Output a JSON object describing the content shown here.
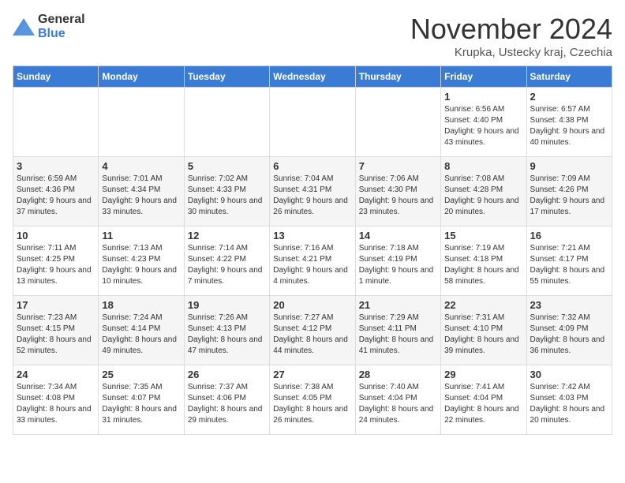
{
  "logo": {
    "general": "General",
    "blue": "Blue"
  },
  "title": "November 2024",
  "location": "Krupka, Ustecky kraj, Czechia",
  "days_of_week": [
    "Sunday",
    "Monday",
    "Tuesday",
    "Wednesday",
    "Thursday",
    "Friday",
    "Saturday"
  ],
  "weeks": [
    [
      {
        "day": "",
        "info": ""
      },
      {
        "day": "",
        "info": ""
      },
      {
        "day": "",
        "info": ""
      },
      {
        "day": "",
        "info": ""
      },
      {
        "day": "",
        "info": ""
      },
      {
        "day": "1",
        "info": "Sunrise: 6:56 AM\nSunset: 4:40 PM\nDaylight: 9 hours and 43 minutes."
      },
      {
        "day": "2",
        "info": "Sunrise: 6:57 AM\nSunset: 4:38 PM\nDaylight: 9 hours and 40 minutes."
      }
    ],
    [
      {
        "day": "3",
        "info": "Sunrise: 6:59 AM\nSunset: 4:36 PM\nDaylight: 9 hours and 37 minutes."
      },
      {
        "day": "4",
        "info": "Sunrise: 7:01 AM\nSunset: 4:34 PM\nDaylight: 9 hours and 33 minutes."
      },
      {
        "day": "5",
        "info": "Sunrise: 7:02 AM\nSunset: 4:33 PM\nDaylight: 9 hours and 30 minutes."
      },
      {
        "day": "6",
        "info": "Sunrise: 7:04 AM\nSunset: 4:31 PM\nDaylight: 9 hours and 26 minutes."
      },
      {
        "day": "7",
        "info": "Sunrise: 7:06 AM\nSunset: 4:30 PM\nDaylight: 9 hours and 23 minutes."
      },
      {
        "day": "8",
        "info": "Sunrise: 7:08 AM\nSunset: 4:28 PM\nDaylight: 9 hours and 20 minutes."
      },
      {
        "day": "9",
        "info": "Sunrise: 7:09 AM\nSunset: 4:26 PM\nDaylight: 9 hours and 17 minutes."
      }
    ],
    [
      {
        "day": "10",
        "info": "Sunrise: 7:11 AM\nSunset: 4:25 PM\nDaylight: 9 hours and 13 minutes."
      },
      {
        "day": "11",
        "info": "Sunrise: 7:13 AM\nSunset: 4:23 PM\nDaylight: 9 hours and 10 minutes."
      },
      {
        "day": "12",
        "info": "Sunrise: 7:14 AM\nSunset: 4:22 PM\nDaylight: 9 hours and 7 minutes."
      },
      {
        "day": "13",
        "info": "Sunrise: 7:16 AM\nSunset: 4:21 PM\nDaylight: 9 hours and 4 minutes."
      },
      {
        "day": "14",
        "info": "Sunrise: 7:18 AM\nSunset: 4:19 PM\nDaylight: 9 hours and 1 minute."
      },
      {
        "day": "15",
        "info": "Sunrise: 7:19 AM\nSunset: 4:18 PM\nDaylight: 8 hours and 58 minutes."
      },
      {
        "day": "16",
        "info": "Sunrise: 7:21 AM\nSunset: 4:17 PM\nDaylight: 8 hours and 55 minutes."
      }
    ],
    [
      {
        "day": "17",
        "info": "Sunrise: 7:23 AM\nSunset: 4:15 PM\nDaylight: 8 hours and 52 minutes."
      },
      {
        "day": "18",
        "info": "Sunrise: 7:24 AM\nSunset: 4:14 PM\nDaylight: 8 hours and 49 minutes."
      },
      {
        "day": "19",
        "info": "Sunrise: 7:26 AM\nSunset: 4:13 PM\nDaylight: 8 hours and 47 minutes."
      },
      {
        "day": "20",
        "info": "Sunrise: 7:27 AM\nSunset: 4:12 PM\nDaylight: 8 hours and 44 minutes."
      },
      {
        "day": "21",
        "info": "Sunrise: 7:29 AM\nSunset: 4:11 PM\nDaylight: 8 hours and 41 minutes."
      },
      {
        "day": "22",
        "info": "Sunrise: 7:31 AM\nSunset: 4:10 PM\nDaylight: 8 hours and 39 minutes."
      },
      {
        "day": "23",
        "info": "Sunrise: 7:32 AM\nSunset: 4:09 PM\nDaylight: 8 hours and 36 minutes."
      }
    ],
    [
      {
        "day": "24",
        "info": "Sunrise: 7:34 AM\nSunset: 4:08 PM\nDaylight: 8 hours and 33 minutes."
      },
      {
        "day": "25",
        "info": "Sunrise: 7:35 AM\nSunset: 4:07 PM\nDaylight: 8 hours and 31 minutes."
      },
      {
        "day": "26",
        "info": "Sunrise: 7:37 AM\nSunset: 4:06 PM\nDaylight: 8 hours and 29 minutes."
      },
      {
        "day": "27",
        "info": "Sunrise: 7:38 AM\nSunset: 4:05 PM\nDaylight: 8 hours and 26 minutes."
      },
      {
        "day": "28",
        "info": "Sunrise: 7:40 AM\nSunset: 4:04 PM\nDaylight: 8 hours and 24 minutes."
      },
      {
        "day": "29",
        "info": "Sunrise: 7:41 AM\nSunset: 4:04 PM\nDaylight: 8 hours and 22 minutes."
      },
      {
        "day": "30",
        "info": "Sunrise: 7:42 AM\nSunset: 4:03 PM\nDaylight: 8 hours and 20 minutes."
      }
    ]
  ]
}
